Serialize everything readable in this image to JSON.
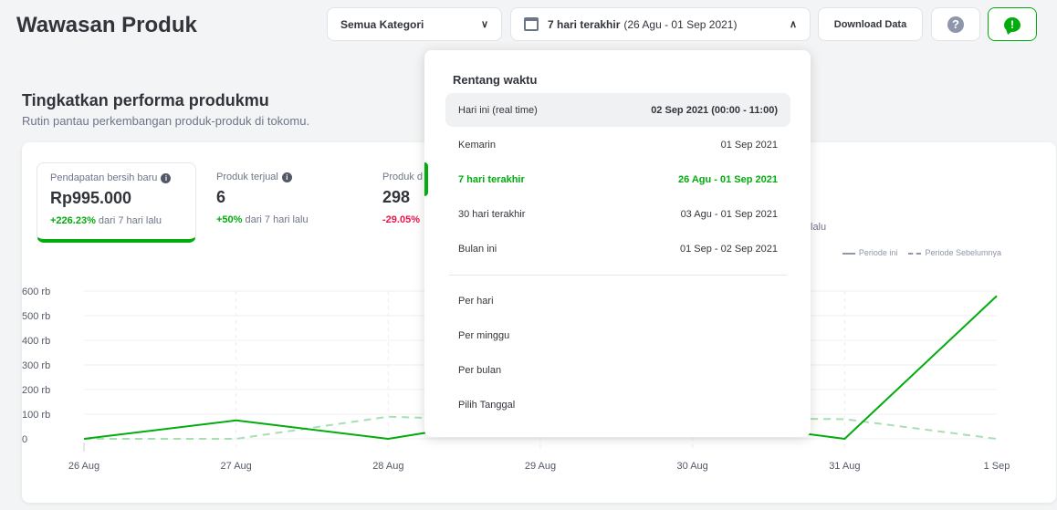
{
  "header": {
    "title": "Wawasan Produk",
    "category_label": "Semua Kategori",
    "date_label": "7 hari terakhir",
    "date_range": "(26 Agu - 01 Sep 2021)",
    "download_label": "Download Data",
    "help_symbol": "?",
    "feedback_symbol": "!"
  },
  "section": {
    "title": "Tingkatkan performa produkmu",
    "subtitle": "Rutin pantau perkembangan produk-produk di tokomu."
  },
  "metrics": [
    {
      "label": "Pendapatan bersih baru",
      "value": "Rp995.000",
      "change": "+226.23%",
      "change_suffix": " dari 7 hari lalu"
    },
    {
      "label": "Produk terjual",
      "value": "6",
      "change": "+50%",
      "change_suffix": " dari 7 hari lalu"
    },
    {
      "label": "Produk d",
      "value": "298",
      "change": "-29.05%",
      "change_suffix": ""
    }
  ],
  "hidden_suffix": "lalu",
  "legend": {
    "current": "Periode ini",
    "previous": "Periode Sebelumnya"
  },
  "dropdown": {
    "title": "Rentang waktu",
    "options": [
      {
        "label": "Hari ini (real time)",
        "range": "02 Sep 2021 (00:00 - 11:00)"
      },
      {
        "label": "Kemarin",
        "range": "01 Sep 2021"
      },
      {
        "label": "7 hari terakhir",
        "range": "26 Agu - 01 Sep 2021"
      },
      {
        "label": "30 hari terakhir",
        "range": "03 Agu - 01 Sep 2021"
      },
      {
        "label": "Bulan ini",
        "range": "01 Sep - 02 Sep 2021"
      }
    ],
    "granularity": [
      "Per hari",
      "Per minggu",
      "Per bulan",
      "Pilih Tanggal"
    ]
  },
  "colors": {
    "accent": "#03ac0e",
    "negative": "#ef144a",
    "prev_line": "#a8dfb0"
  },
  "chart_data": {
    "type": "line",
    "categories": [
      "26 Aug",
      "27 Aug",
      "28 Aug",
      "29 Aug",
      "30 Aug",
      "31 Aug",
      "1 Sep"
    ],
    "y_ticks": [
      "0",
      "100 rb",
      "200 rb",
      "300 rb",
      "400 rb",
      "500 rb",
      "600 rb"
    ],
    "ylim": [
      0,
      600000
    ],
    "series": [
      {
        "name": "Periode ini",
        "values": [
          0,
          75000,
          0,
          100000,
          80000,
          0,
          580000
        ]
      },
      {
        "name": "Periode Sebelumnya",
        "values": [
          0,
          0,
          90000,
          70000,
          85000,
          80000,
          0
        ]
      }
    ]
  }
}
